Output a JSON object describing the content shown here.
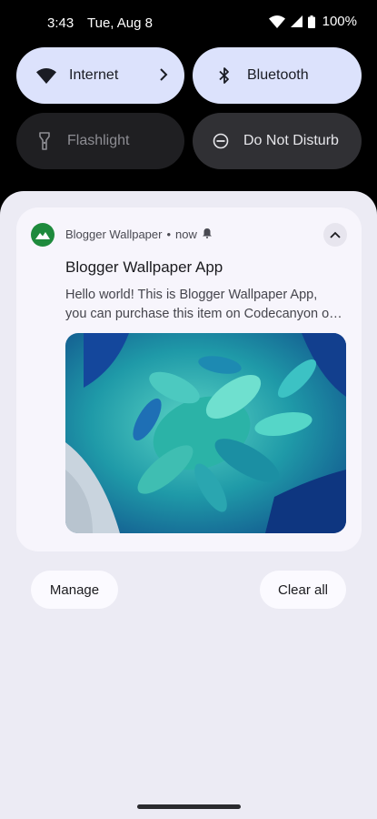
{
  "status_bar": {
    "time": "3:43",
    "date": "Tue, Aug 8",
    "battery": "100%",
    "icons": [
      "wifi-icon",
      "cell-signal-icon",
      "battery-icon"
    ]
  },
  "quick_settings": {
    "tiles": [
      {
        "label": "Internet",
        "icon": "wifi-icon",
        "state": "on",
        "has_chevron": true
      },
      {
        "label": "Bluetooth",
        "icon": "bluetooth-icon",
        "state": "on"
      },
      {
        "label": "Flashlight",
        "icon": "flashlight-icon",
        "state": "off"
      },
      {
        "label": "Do Not Disturb",
        "icon": "do-not-disturb-icon",
        "state": "off"
      }
    ]
  },
  "notification": {
    "app_name": "Blogger Wallpaper",
    "separator": "•",
    "time": "now",
    "title": "Blogger Wallpaper App",
    "body_line_1": "Hello world! This is Blogger Wallpaper App,",
    "body_line_2": "you can purchase this item on Codecanyon o…",
    "app_icon": "mountain-icon",
    "bell_icon": "bell-icon",
    "expand_icon": "chevron-up-icon",
    "accent_color": "#1e8a3c"
  },
  "actions": {
    "manage_label": "Manage",
    "clear_all_label": "Clear all"
  }
}
